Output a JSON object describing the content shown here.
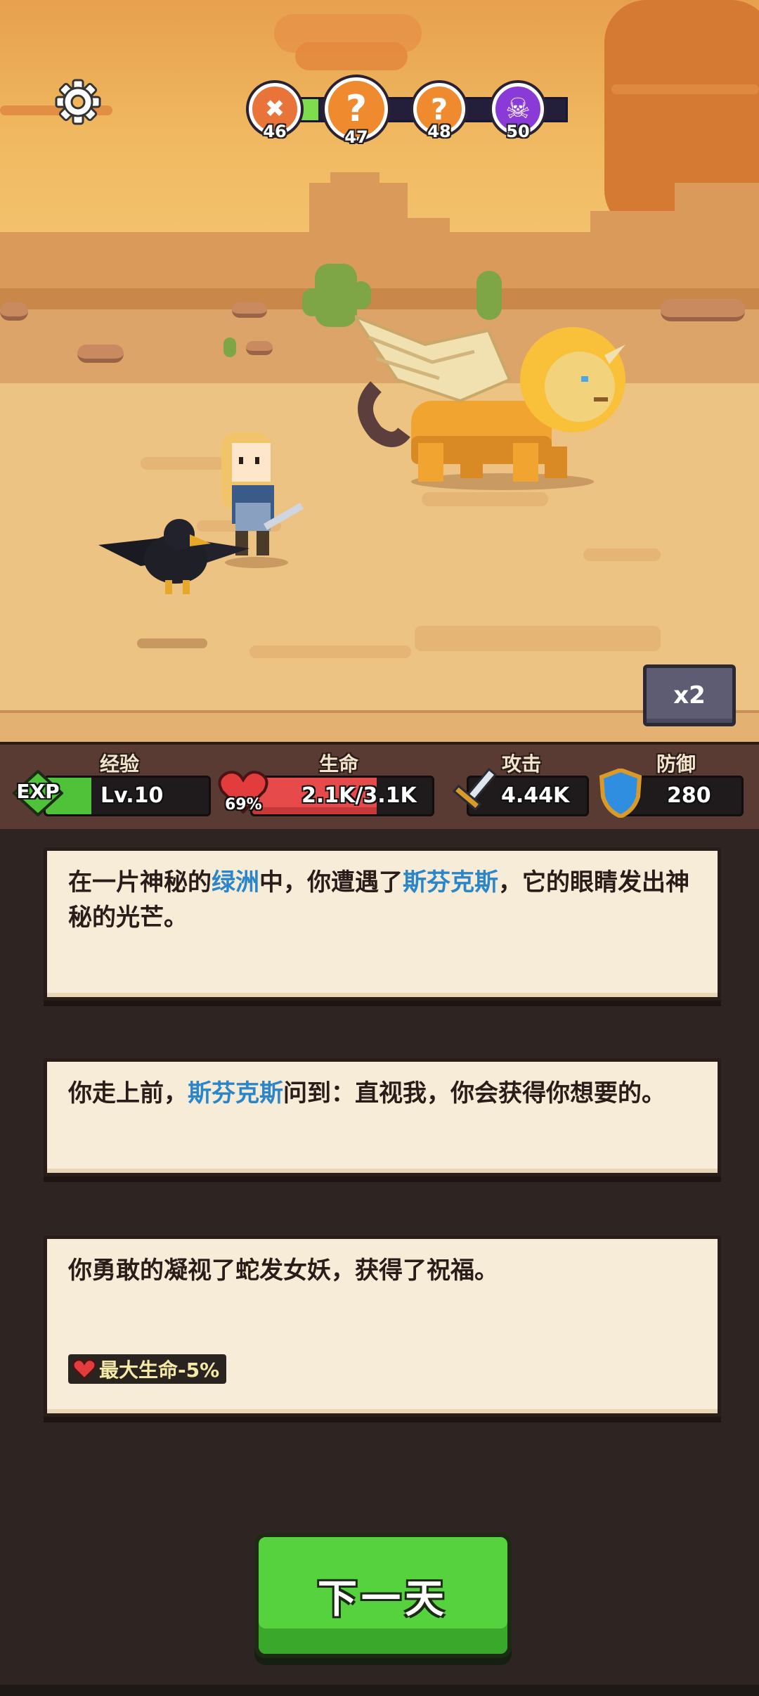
{
  "stages": [
    {
      "num": "46",
      "icon": "crossed-swords-icon",
      "glyph": "✖",
      "color": "#e9743a"
    },
    {
      "num": "47",
      "icon": "question-icon",
      "glyph": "?",
      "color": "#f08a2e"
    },
    {
      "num": "48",
      "icon": "question-icon",
      "glyph": "?",
      "color": "#f08a2e"
    },
    {
      "num": "50",
      "icon": "skull-icon",
      "glyph": "☠",
      "color": "#8a3ad6"
    }
  ],
  "speed": {
    "label": "x2"
  },
  "stats": {
    "exp": {
      "title": "经验",
      "badge": "EXP",
      "level": "Lv.10",
      "fill": 0.28
    },
    "hp": {
      "title": "生命",
      "value": "2.1K/3.1K",
      "percent": "69%",
      "fill": 0.69
    },
    "attack": {
      "title": "攻击",
      "value": "4.44K"
    },
    "defense": {
      "title": "防御",
      "value": "280"
    }
  },
  "events": [
    {
      "parts": [
        "在一片神秘的",
        "绿洲",
        "中，你遭遇了",
        "斯芬克斯",
        "，它的眼睛发出神秘的光芒。"
      ]
    },
    {
      "parts": [
        "你走上前，",
        "斯芬克斯",
        "问到：直视我，你会获得你想要的。"
      ]
    },
    {
      "text": "你勇敢的凝视了蛇发女妖，获得了祝福。",
      "effect": "最大生命-5%"
    }
  ],
  "next_button": {
    "label": "下一天"
  },
  "colors": {
    "highlight": "#2a86c9",
    "button": "#56d23e"
  }
}
